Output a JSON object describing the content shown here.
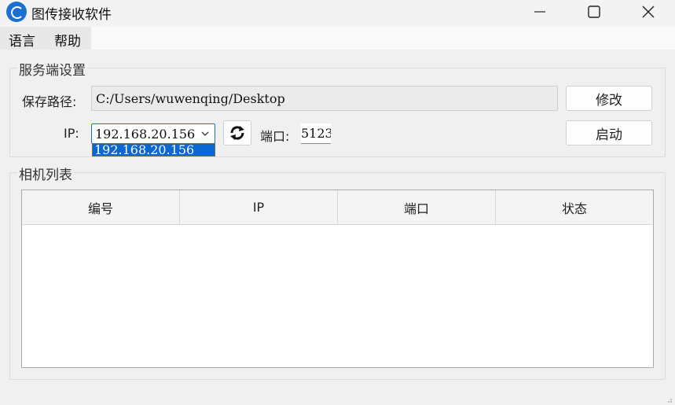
{
  "window": {
    "title": "图传接收软件",
    "app_icon": "app-logo-icon",
    "controls": [
      "minimize-icon",
      "maximize-icon",
      "close-icon"
    ]
  },
  "menu": {
    "items": [
      {
        "label": "语言"
      },
      {
        "label": "帮助"
      }
    ]
  },
  "server_settings": {
    "group_title": "服务端设置",
    "save_path_label": "保存路径:",
    "save_path_value": "C:/Users/wuwenqing/Desktop",
    "modify_button": "修改",
    "ip_label": "IP:",
    "ip_selected": "192.168.20.156",
    "ip_options": [
      "192.168.20.156"
    ],
    "refresh_icon": "refresh-icon",
    "port_label": "端口:",
    "port_value": "5123",
    "start_button": "启动"
  },
  "camera_list": {
    "group_title": "相机列表",
    "columns": [
      "编号",
      "IP",
      "端口",
      "状态"
    ],
    "rows": []
  },
  "colors": {
    "accent": "#0b67d2",
    "background": "#f0f0f0"
  }
}
